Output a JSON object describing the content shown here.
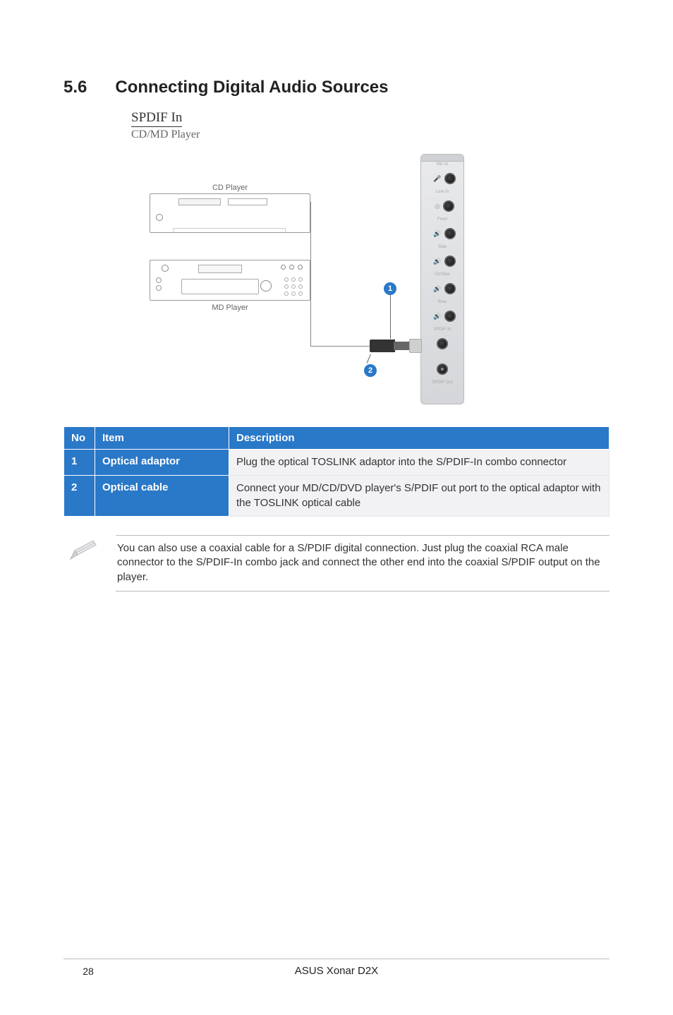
{
  "section": {
    "number": "5.6",
    "title": "Connecting Digital Audio Sources"
  },
  "diagram": {
    "label_top": "SPDIF In",
    "label_sub": "CD/MD Player",
    "cd_label": "CD Player",
    "md_label": "MD Player",
    "port_labels": {
      "mic": "Mic In",
      "line": "Line In",
      "front": "Front",
      "side": "Side",
      "ctr": "Ctr/Sbw",
      "rear": "Rear",
      "spdif_in": "SPDIF In",
      "spdif_out": "SPDIF Out"
    },
    "callout_1": "1",
    "callout_2": "2"
  },
  "table": {
    "headers": {
      "no": "No",
      "item": "Item",
      "desc": "Description"
    },
    "rows": [
      {
        "no": "1",
        "item": "Optical adaptor",
        "desc": "Plug the optical TOSLINK adaptor into the S/PDIF-In combo connector"
      },
      {
        "no": "2",
        "item": "Optical cable",
        "desc": "Connect your MD/CD/DVD player's S/PDIF out port to the optical adaptor with the TOSLINK optical cable"
      }
    ]
  },
  "note": "You can also use a coaxial cable for a S/PDIF digital connection. Just plug the coaxial RCA male connector to the S/PDIF-In combo jack and connect the other end into the coaxial S/PDIF output on the player.",
  "footer": {
    "page": "28",
    "product": "ASUS Xonar D2X"
  }
}
